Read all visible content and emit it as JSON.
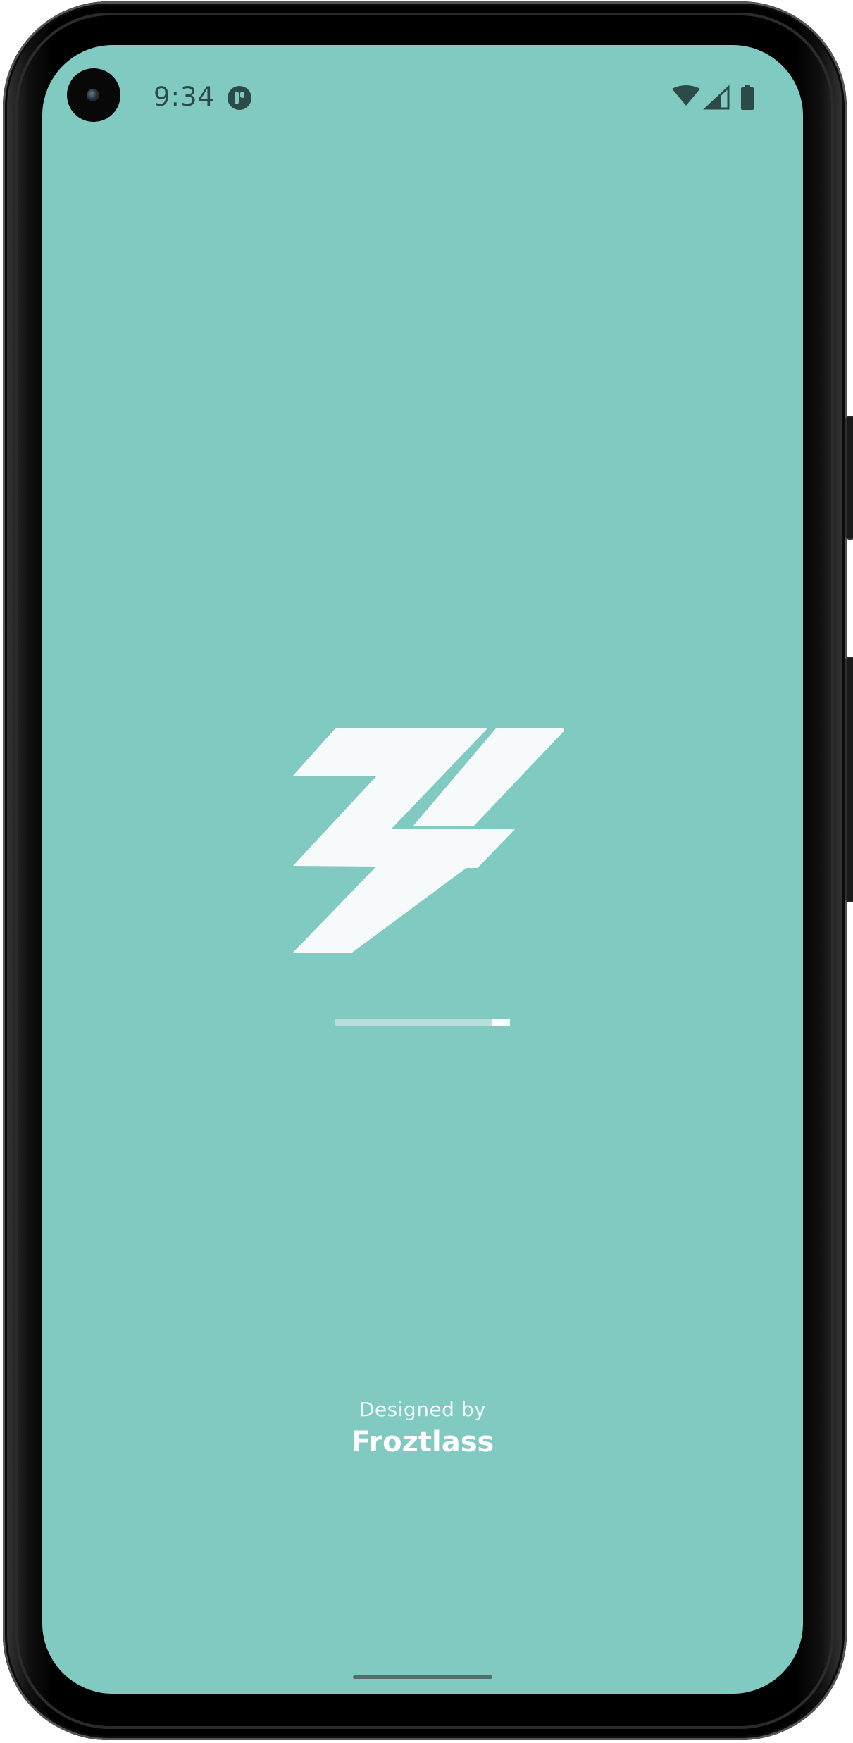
{
  "status_bar": {
    "time": "9:34",
    "app_icon": "notification-app-icon",
    "wifi_icon": "wifi-icon",
    "signal_icon": "cellular-signal-icon",
    "battery_icon": "battery-icon"
  },
  "splash": {
    "logo": "lightning-bolt-logo",
    "progress": 0.9,
    "credit_label": "Designed by",
    "credit_name": "Froztlass"
  },
  "colors": {
    "background": "#80cac2",
    "status_foreground": "#2c4a47",
    "logo": "#f6fafb",
    "progress_track": "#b7dfdb",
    "progress_fill": "#ffffff"
  }
}
